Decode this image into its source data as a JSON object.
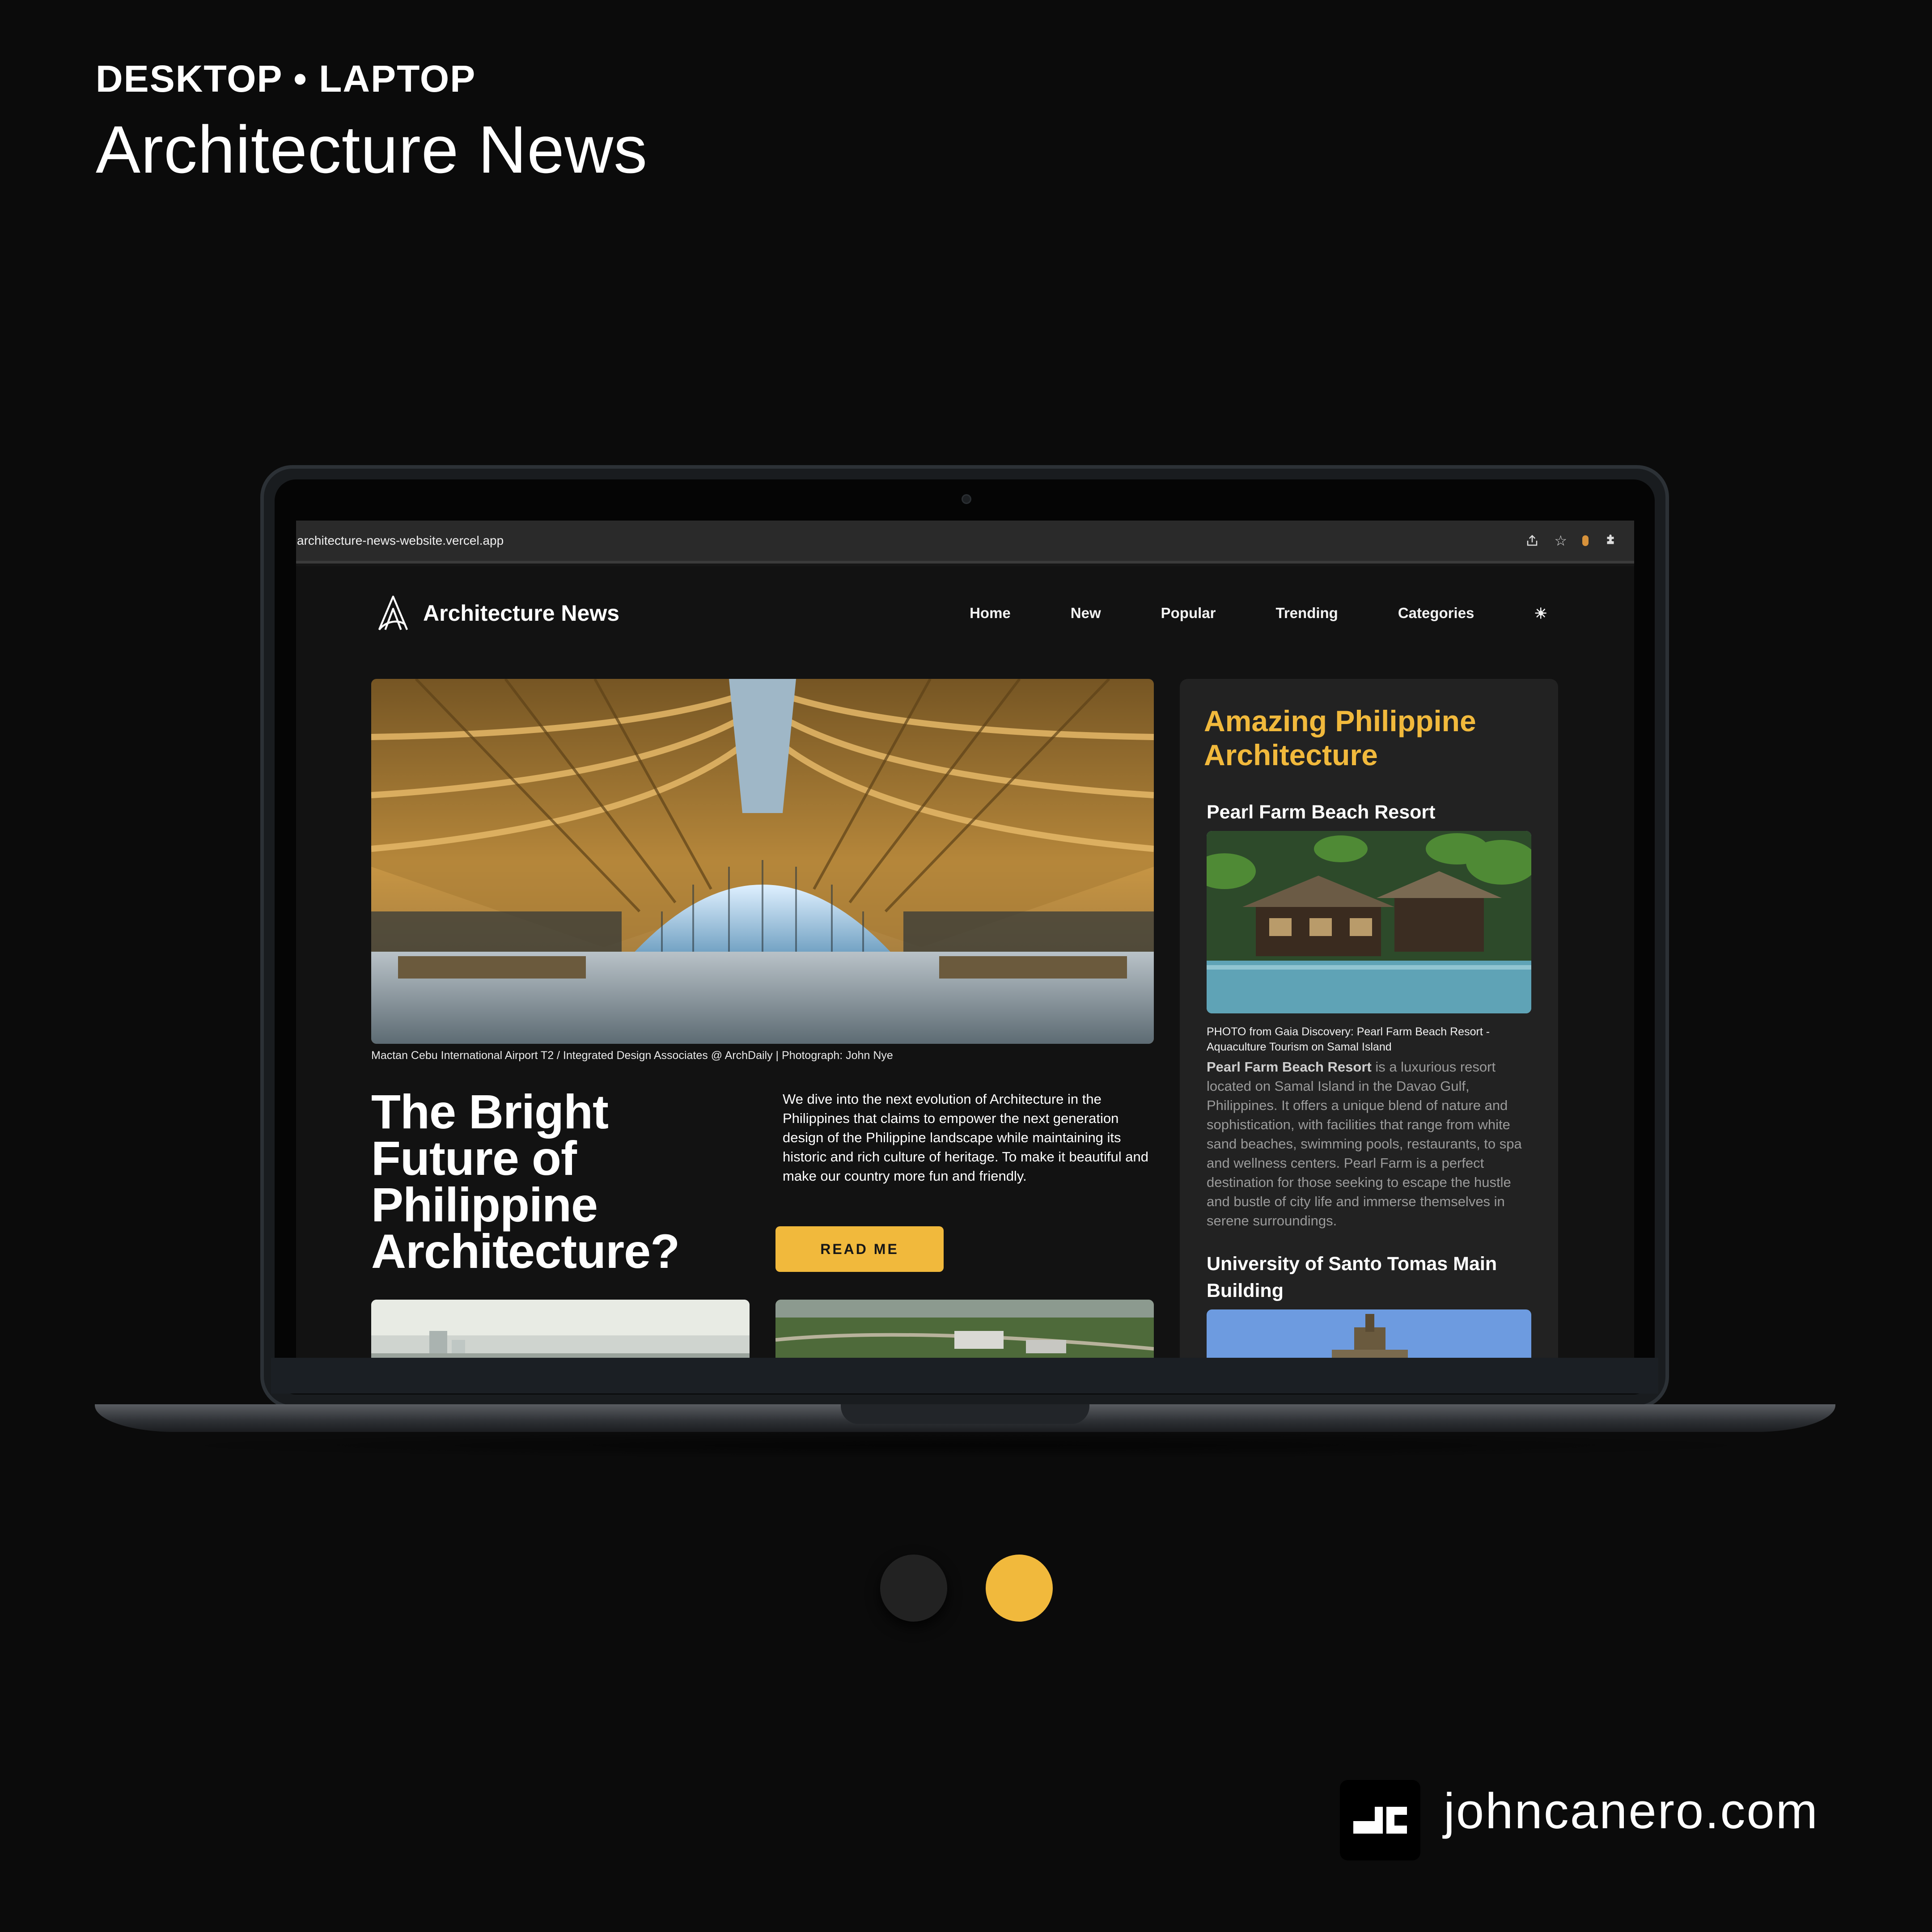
{
  "showcase": {
    "eyebrow": "DESKTOP • LAPTOP",
    "title": "Architecture News",
    "footer_site": "johncanero.com"
  },
  "browser": {
    "url": "architecture-news-website.vercel.app",
    "icons": [
      "share-icon",
      "star-icon",
      "extension-badge-icon",
      "puzzle-icon"
    ]
  },
  "site": {
    "brand": "Architecture News",
    "nav": [
      "Home",
      "New",
      "Popular",
      "Trending",
      "Categories"
    ],
    "theme_toggle_icon": "sun-icon",
    "hero_caption": "Mactan Cebu International Airport T2 / Integrated Design Associates @ ArchDaily | Photograph: John Nye",
    "headline": "The Bright Future of Philippine Architecture?",
    "intro": "We dive into the next evolution of Architecture in the Philippines that claims to empower the next generation design of the Philippine landscape while maintaining its historic and rich culture of heritage. To make it beautiful and make our country more fun and friendly.",
    "cta": "READ ME"
  },
  "sidebar": {
    "title": "Amazing Philippine Architecture",
    "items": [
      {
        "heading": "Pearl Farm Beach Resort",
        "photo_caption": "PHOTO from Gaia Discovery: Pearl Farm Beach Resort - Aquaculture Tourism on Samal Island",
        "lead": "Pearl Farm Beach Resort",
        "body": " is a luxurious resort located on Samal Island in the Davao Gulf, Philippines. It offers a unique blend of nature and sophistication, with facilities that range from white sand beaches, swimming pools, restaurants, to spa and wellness centers. Pearl Farm is a perfect destination for those seeking to escape the hustle and bustle of city life and immerse themselves in serene surroundings."
      },
      {
        "heading": "University of Santo Tomas Main Building"
      }
    ]
  },
  "colors": {
    "accent": "#f1b93c",
    "background": "#0b0b0b",
    "site_background": "#121212",
    "sidebar_background": "#222222"
  },
  "carousel": {
    "slides": 2,
    "active_slide": 2
  }
}
